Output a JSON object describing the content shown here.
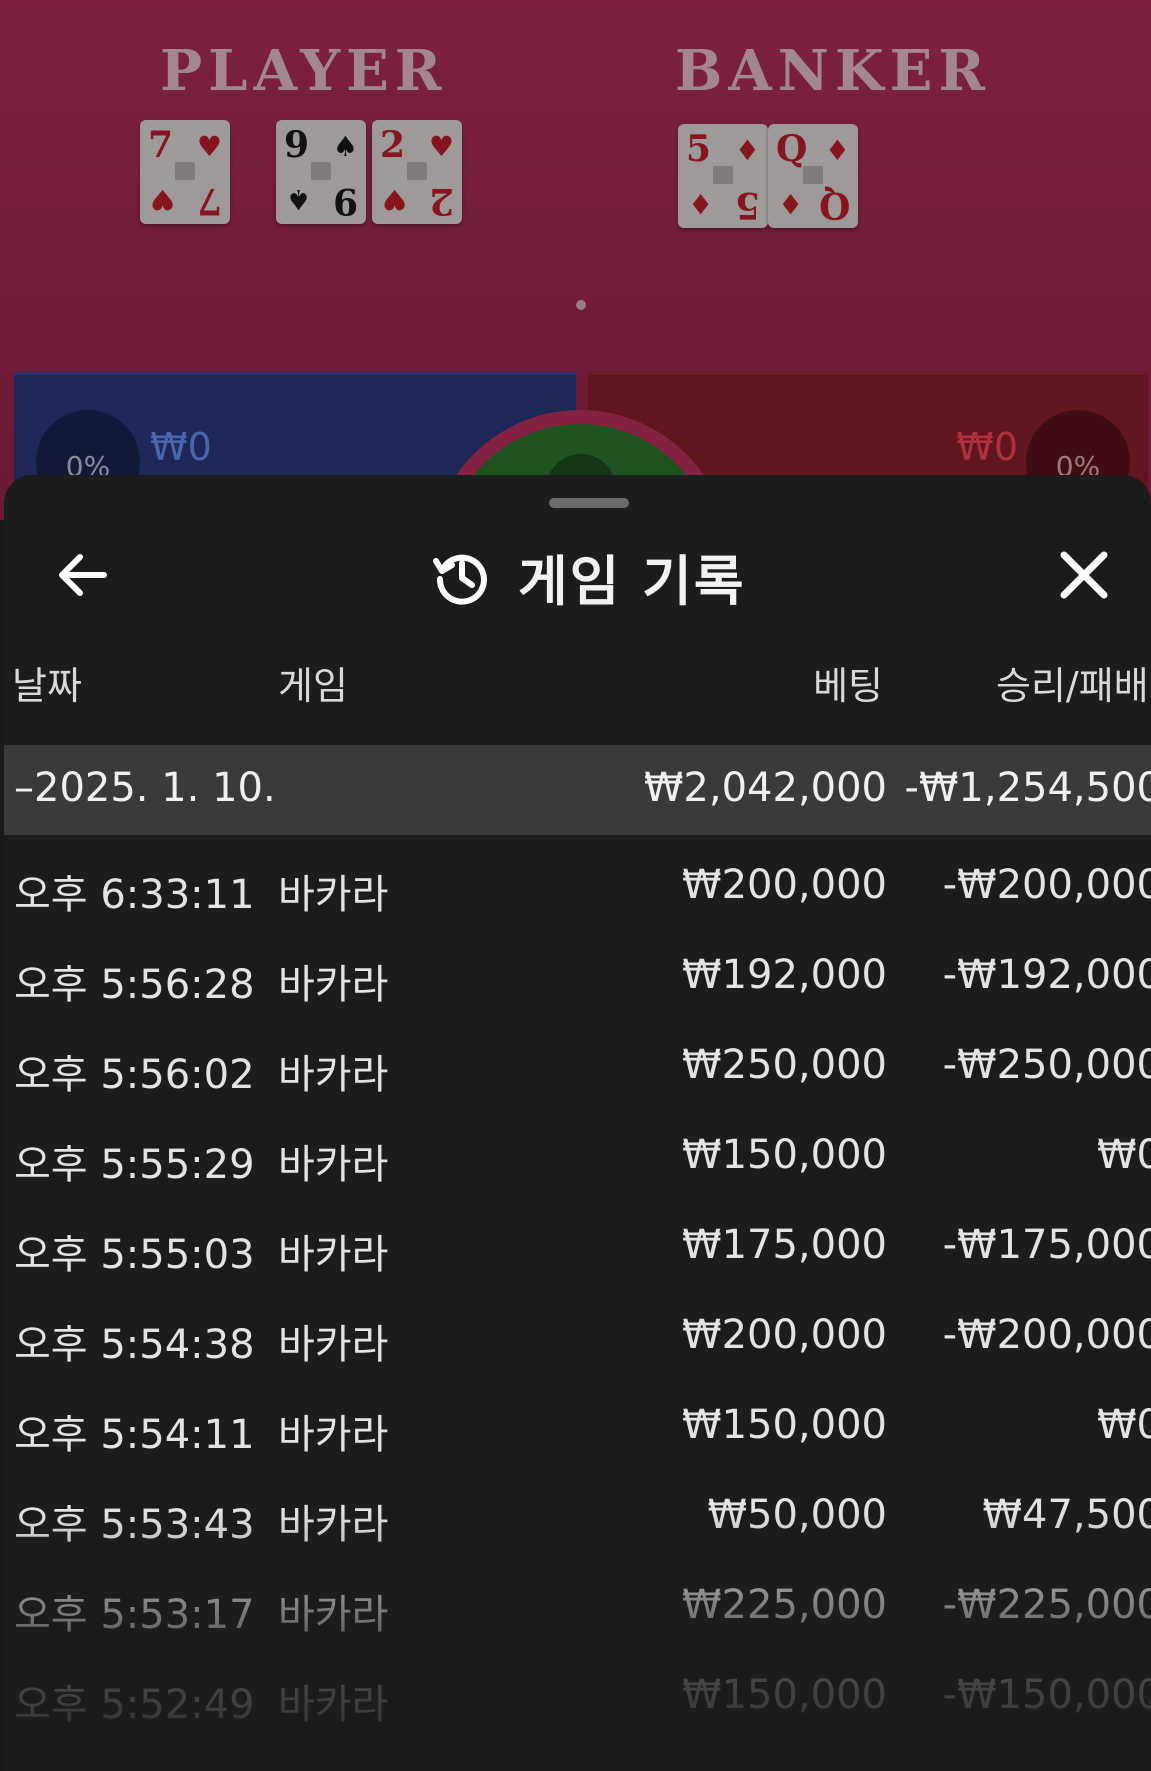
{
  "table": {
    "player_label": "PLAYER",
    "banker_label": "BANKER",
    "player_cards": [
      {
        "rank": "7",
        "suit": "♥",
        "color": "red"
      },
      {
        "rank": "9",
        "suit": "♠",
        "color": "black"
      },
      {
        "rank": "2",
        "suit": "♥",
        "color": "red"
      }
    ],
    "banker_cards": [
      {
        "rank": "5",
        "suit": "♦",
        "color": "red"
      },
      {
        "rank": "Q",
        "suit": "♦",
        "color": "red"
      }
    ],
    "player_bet": {
      "percent": "0%",
      "amount": "₩0"
    },
    "banker_bet": {
      "percent": "0%",
      "amount": "₩0"
    }
  },
  "sheet": {
    "title": "게임 기록",
    "icons": {
      "back": "arrow-left-icon",
      "history": "history-icon",
      "close": "close-icon"
    },
    "columns": {
      "date": "날짜",
      "game": "게임",
      "bet": "베팅",
      "result": "승리/패배"
    },
    "group": {
      "date": "–2025. 1. 10.",
      "bet": "₩2,042,000",
      "result": "-₩1,254,500"
    },
    "rows": [
      {
        "time": "오후 6:33:11",
        "game": "바카라",
        "bet": "₩200,000",
        "result": "-₩200,000"
      },
      {
        "time": "오후 5:56:28",
        "game": "바카라",
        "bet": "₩192,000",
        "result": "-₩192,000"
      },
      {
        "time": "오후 5:56:02",
        "game": "바카라",
        "bet": "₩250,000",
        "result": "-₩250,000"
      },
      {
        "time": "오후 5:55:29",
        "game": "바카라",
        "bet": "₩150,000",
        "result": "₩0"
      },
      {
        "time": "오후 5:55:03",
        "game": "바카라",
        "bet": "₩175,000",
        "result": "-₩175,000"
      },
      {
        "time": "오후 5:54:38",
        "game": "바카라",
        "bet": "₩200,000",
        "result": "-₩200,000"
      },
      {
        "time": "오후 5:54:11",
        "game": "바카라",
        "bet": "₩150,000",
        "result": "₩0"
      },
      {
        "time": "오후 5:53:43",
        "game": "바카라",
        "bet": "₩50,000",
        "result": "₩47,500"
      },
      {
        "time": "오후 5:53:17",
        "game": "바카라",
        "bet": "₩225,000",
        "result": "-₩225,000"
      },
      {
        "time": "오후 5:52:49",
        "game": "바카라",
        "bet": "₩150,000",
        "result": "-₩150,000"
      }
    ]
  },
  "colors": {
    "sheet_bg": "#1c1c1c",
    "group_bg": "#3a3a3a",
    "player_blue": "#2c3a82",
    "banker_red": "#8f1f2c"
  }
}
